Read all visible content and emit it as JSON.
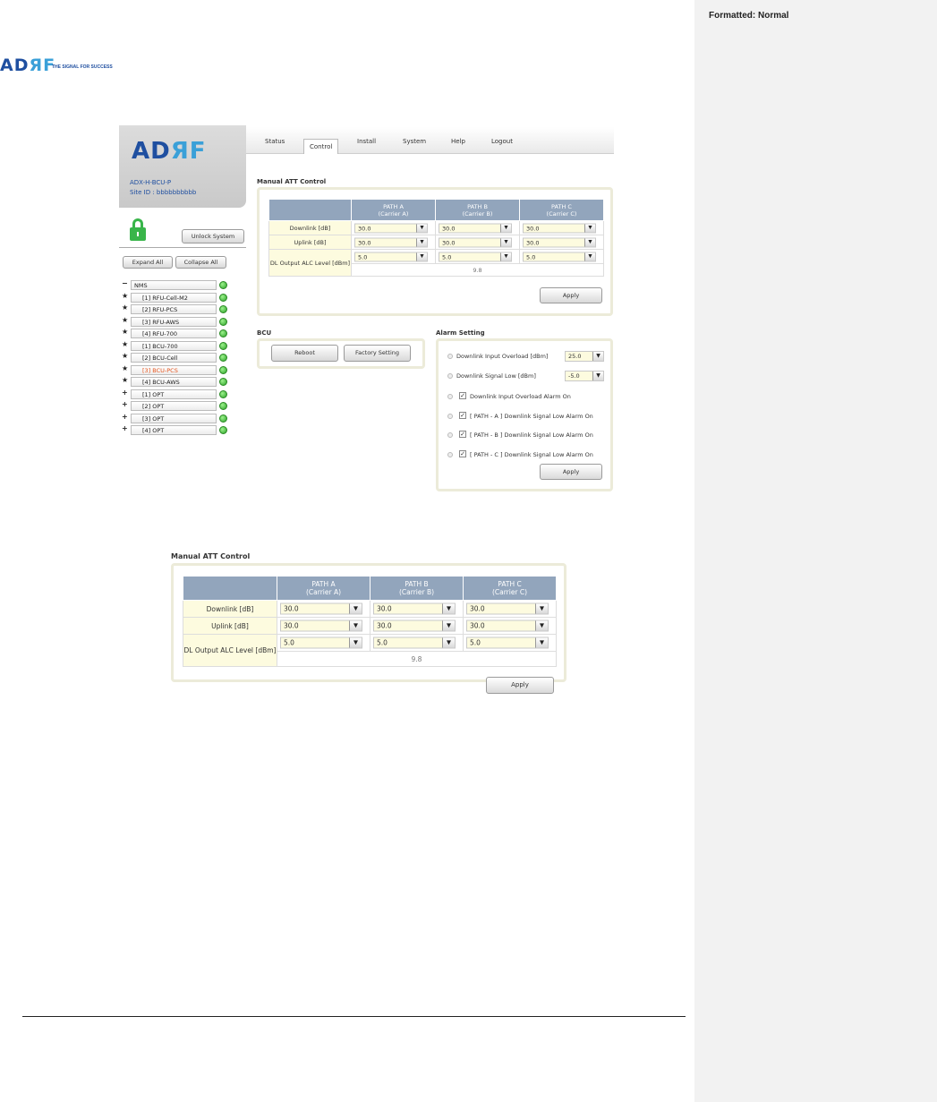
{
  "doc": {
    "comment_label": "Formatted: Normal",
    "logo_mark_left": "AD",
    "logo_mark_right": "ЯF",
    "logo_tagline": "THE SIGNAL FOR SUCCESS"
  },
  "app": {
    "brand": {
      "logo_left": "AD",
      "logo_right": "ЯF",
      "model": "ADX-H-BCU-P",
      "site_id": "Site ID : bbbbbbbbbb"
    },
    "tabs": [
      "Status",
      "Control",
      "Install",
      "System",
      "Help",
      "Logout"
    ],
    "active_tab": "Control",
    "unlock_label": "Unlock System",
    "expand_label": "Expand All",
    "collapse_label": "Collapse All",
    "tree": [
      {
        "symbol": "−",
        "label": "NMS",
        "status": "green"
      },
      {
        "symbol": "★",
        "label": "[1] RFU-Cell-M2",
        "status": "green"
      },
      {
        "symbol": "★",
        "label": "[2] RFU-PCS",
        "status": "green"
      },
      {
        "symbol": "★",
        "label": "[3] RFU-AWS",
        "status": "green"
      },
      {
        "symbol": "★",
        "label": "[4] RFU-700",
        "status": "green"
      },
      {
        "symbol": "★",
        "label": "[1] BCU-700",
        "status": "green"
      },
      {
        "symbol": "★",
        "label": "[2] BCU-Cell",
        "status": "green"
      },
      {
        "symbol": "★",
        "label": "[3] BCU-PCS",
        "status": "green",
        "selected": true
      },
      {
        "symbol": "★",
        "label": "[4] BCU-AWS",
        "status": "green"
      },
      {
        "symbol": "+",
        "label": "[1] OPT",
        "status": "green"
      },
      {
        "symbol": "+",
        "label": "[2] OPT",
        "status": "green"
      },
      {
        "symbol": "+",
        "label": "[3] OPT",
        "status": "green"
      },
      {
        "symbol": "+",
        "label": "[4] OPT",
        "status": "green"
      }
    ],
    "bcu": {
      "title": "BCU",
      "reboot_label": "Reboot",
      "factory_label": "Factory Setting"
    },
    "alarm": {
      "title": "Alarm Setting",
      "input_overload_label": "Downlink Input Overload [dBm]",
      "input_overload_value": "25.0",
      "signal_low_label": "Downlink Signal Low [dBm]",
      "signal_low_value": "-5.0",
      "checks": [
        "Downlink Input Overload Alarm On",
        "[ PATH - A ] Downlink Signal Low Alarm On",
        "[ PATH - B ] Downlink Signal Low Alarm On",
        "[ PATH - C ] Downlink Signal Low Alarm On"
      ],
      "apply_label": "Apply"
    }
  },
  "manual_att": {
    "title": "Manual ATT Control",
    "headers": [
      {
        "path": "PATH A",
        "carrier": "(Carrier A)"
      },
      {
        "path": "PATH B",
        "carrier": "(Carrier B)"
      },
      {
        "path": "PATH C",
        "carrier": "(Carrier C)"
      }
    ],
    "rows": [
      {
        "label": "Downlink [dB]",
        "values": [
          "30.0",
          "30.0",
          "30.0"
        ]
      },
      {
        "label": "Uplink [dB]",
        "values": [
          "30.0",
          "30.0",
          "30.0"
        ]
      },
      {
        "label": "DL Output ALC Level [dBm]",
        "values": [
          "5.0",
          "5.0",
          "5.0"
        ]
      }
    ],
    "alc_reading": "9.8",
    "apply_label": "Apply"
  }
}
